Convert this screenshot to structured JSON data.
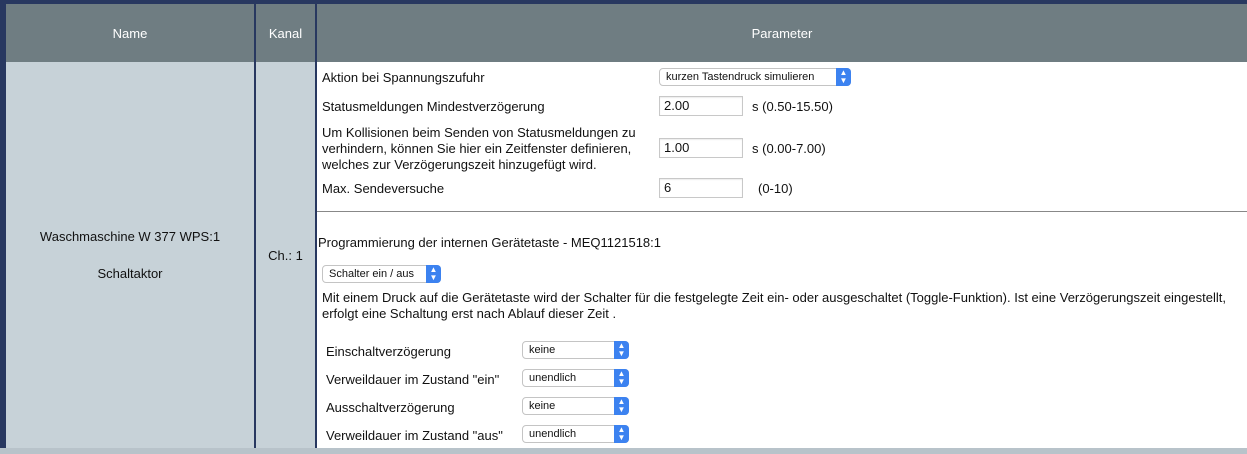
{
  "header": {
    "name": "Name",
    "kanal": "Kanal",
    "parameter": "Parameter"
  },
  "device": {
    "name": "Waschmaschine W 377 WPS:1",
    "type": "Schaltaktor",
    "channel": "Ch.: 1"
  },
  "params": {
    "power_on_action": {
      "label": "Aktion bei Spannungszufuhr",
      "value": "kurzen Tastendruck simulieren"
    },
    "status_delay": {
      "label": "Statusmeldungen Mindestverzögerung",
      "value": "2.00",
      "range": "s (0.50-15.50)"
    },
    "collision": {
      "label": "Um Kollisionen beim Senden von Statusmeldungen zu verhindern, können Sie hier ein Zeitfenster definieren, welches zur Verzögerungszeit hinzugefügt wird.",
      "value": "1.00",
      "range": "s (0.00-7.00)"
    },
    "max_send": {
      "label": "Max. Sendeversuche",
      "value": "6",
      "range": "(0-10)"
    }
  },
  "programming": {
    "title": "Programmierung der internen Gerätetaste - MEQ1121518:1",
    "mode": "Schalter ein / aus",
    "description": "Mit einem Druck auf die Gerätetaste wird der Schalter für die festgelegte Zeit ein- oder ausgeschaltet (Toggle-Funktion). Ist eine Verzögerungszeit eingestellt, erfolgt eine Schaltung erst nach Ablauf dieser Zeit .",
    "rows": [
      {
        "label": "Einschaltverzögerung",
        "value": "keine"
      },
      {
        "label": "Verweildauer im Zustand \"ein\"",
        "value": "unendlich"
      },
      {
        "label": "Ausschaltverzögerung",
        "value": "keine"
      },
      {
        "label": "Verweildauer im Zustand \"aus\"",
        "value": "unendlich"
      }
    ]
  }
}
